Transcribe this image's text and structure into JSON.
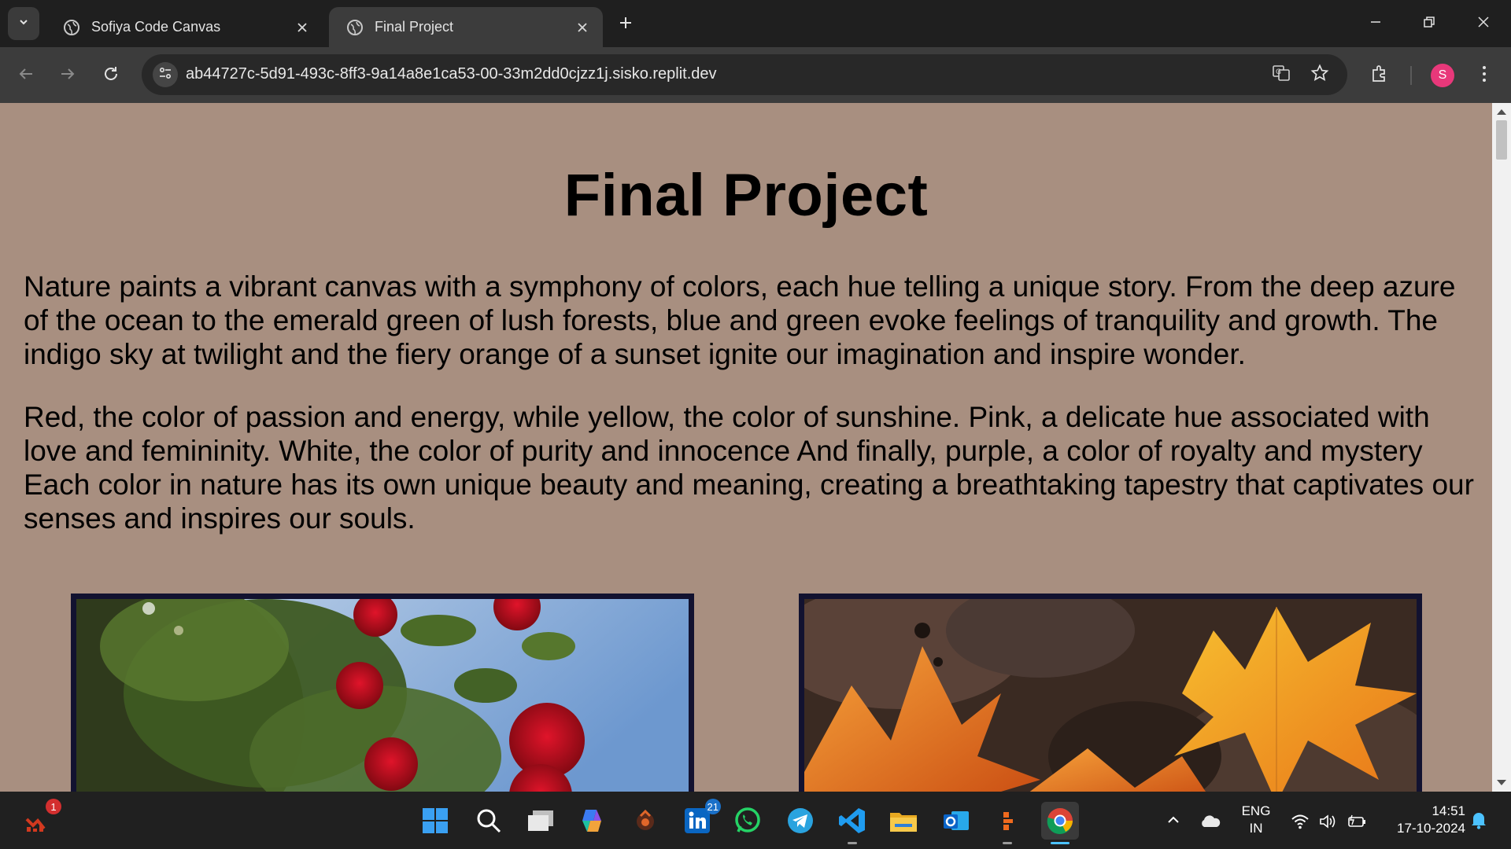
{
  "browser": {
    "tabs": [
      {
        "title": "Sofiya Code Canvas",
        "active": false
      },
      {
        "title": "Final Project",
        "active": true
      }
    ],
    "url": "ab44727c-5d91-493c-8ff3-9a14a8e1ca53-00-33m2dd0cjzz1j.sisko.replit.dev",
    "profile_initial": "S"
  },
  "page": {
    "title": "Final Project",
    "paragraphs": [
      "Nature paints a vibrant canvas with a symphony of colors, each hue telling a unique story. From the deep azure of the ocean to the emerald green of lush forests, blue and green evoke feelings of tranquility and growth. The indigo sky at twilight and the fiery orange of a sunset ignite our imagination and inspire wonder.",
      "Red, the color of passion and energy, while yellow, the color of sunshine. Pink, a delicate hue associated with love and femininity. White, the color of purity and innocence And finally, purple, a color of royalty and mystery Each color in nature has its own unique beauty and meaning, creating a breathtaking tapestry that captivates our senses and inspires our souls."
    ],
    "images": [
      {
        "icon": "red-roses-image"
      },
      {
        "icon": "autumn-leaves-image"
      }
    ]
  },
  "taskbar": {
    "apps": [
      {
        "name": "task-manager-icon",
        "badge": "1"
      },
      {
        "name": "start-icon"
      },
      {
        "name": "search-icon"
      },
      {
        "name": "task-view-icon"
      },
      {
        "name": "copilot-icon"
      },
      {
        "name": "app-icon"
      },
      {
        "name": "linkedin-icon",
        "badge": "21"
      },
      {
        "name": "whatsapp-icon"
      },
      {
        "name": "telegram-icon"
      },
      {
        "name": "vscode-icon"
      },
      {
        "name": "file-explorer-icon"
      },
      {
        "name": "outlook-icon"
      },
      {
        "name": "app-icon"
      },
      {
        "name": "chrome-icon"
      }
    ],
    "language_line1": "ENG",
    "language_line2": "IN",
    "time": "14:51",
    "date": "17-10-2024"
  },
  "colors": {
    "page_background": "#a88f80",
    "image_border": "#121230",
    "tab_strip": "#1f1f1f",
    "toolbar": "#3c3c3c",
    "taskbar": "#202020",
    "profile_avatar": "#e8387a"
  }
}
